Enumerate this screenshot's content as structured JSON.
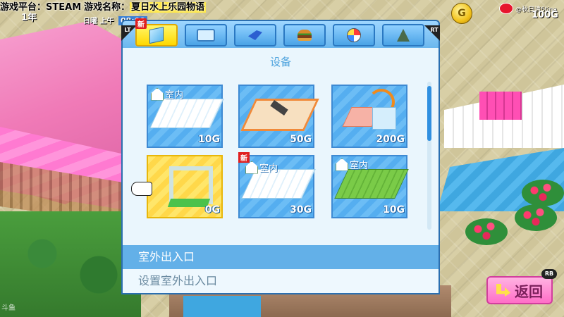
{
  "ticker": {
    "platform_label": "游戏平台：",
    "platform": "STEAM",
    "name_label": "游戏名称：",
    "game_name": "夏日水上乐园物语"
  },
  "hud": {
    "year": "1年",
    "day_label": "日曜",
    "ampm": "上午",
    "clock": "08:00",
    "money": "100G",
    "coin_symbol": "G",
    "weibo_label": "@秋日清Stina"
  },
  "panel": {
    "tabs": [
      {
        "icon": "cube-icon",
        "active": true,
        "badge": "新"
      },
      {
        "icon": "bathtub-icon"
      },
      {
        "icon": "beach-chair-icon"
      },
      {
        "icon": "burger-icon"
      },
      {
        "icon": "beach-ball-icon"
      },
      {
        "icon": "tree-icon"
      }
    ],
    "lt_label": "LT",
    "rt_label": "RT",
    "category_title": "设备",
    "items": [
      {
        "indoor_label": "室内",
        "price": "10G",
        "new": ""
      },
      {
        "indoor_label": "",
        "price": "50G",
        "new": ""
      },
      {
        "indoor_label": "",
        "price": "200G",
        "new": ""
      },
      {
        "indoor_label": "",
        "price": "0G",
        "new": ""
      },
      {
        "indoor_label": "室内",
        "price": "30G",
        "new": "新"
      },
      {
        "indoor_label": "室内",
        "price": "10G",
        "new": ""
      }
    ],
    "selected_name": "室外出入口",
    "selected_desc": "设置室外出入口"
  },
  "back_button": {
    "label": "返回",
    "rb_label": "RB"
  },
  "watermark": "斗鱼",
  "colors": {
    "panel_border": "#2b6fb0",
    "selected_row": "#63b0e8",
    "back_button": "#ff6ec7"
  }
}
